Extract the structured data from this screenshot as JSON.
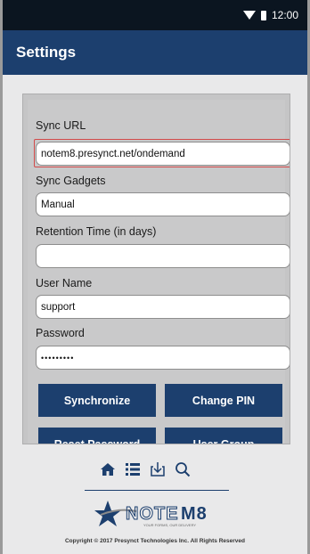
{
  "status_bar": {
    "time": "12:00"
  },
  "app_bar": {
    "title": "Settings"
  },
  "form": {
    "sync_url": {
      "label": "Sync URL",
      "value": "notem8.presynct.net/ondemand"
    },
    "sync_gadgets": {
      "label": "Sync Gadgets",
      "value": "Manual"
    },
    "retention_time": {
      "label": "Retention Time (in days)",
      "value": ""
    },
    "user_name": {
      "label": "User Name",
      "value": "support"
    },
    "password": {
      "label": "Password",
      "value": "•••••••••"
    }
  },
  "buttons": {
    "synchronize": "Synchronize",
    "change_pin": "Change PIN",
    "reset_password": "Reset Password",
    "user_group": "User Group"
  },
  "footer": {
    "icons": [
      "home-icon",
      "list-icon",
      "download-icon",
      "search-icon"
    ],
    "logo_text": "NOTEM8",
    "logo_tagline": "YOUR FORMS, OUR DELIVERY",
    "copyright": "Copyright © 2017 Presynct Technologies Inc. All Rights Reserved"
  },
  "colors": {
    "brand_navy": "#1c3f6e",
    "highlight_red": "#d24a4a"
  }
}
